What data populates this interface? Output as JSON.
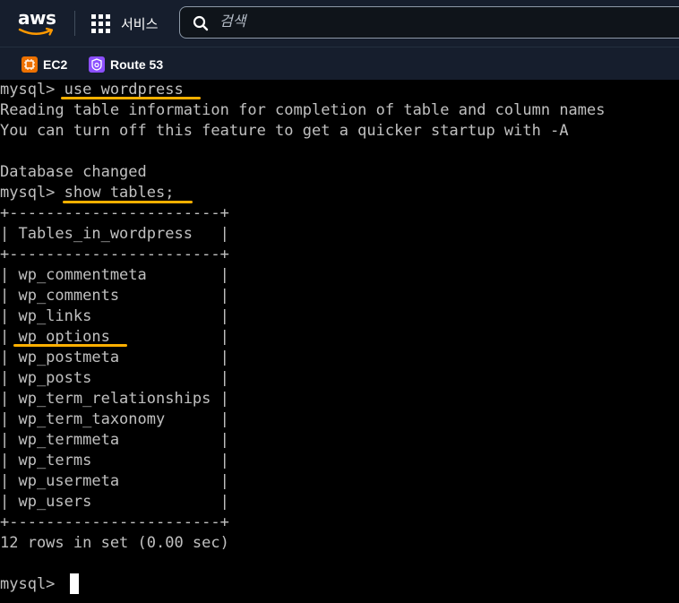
{
  "header": {
    "logo_text": "aws",
    "services_label": "서비스",
    "search_placeholder": "검색"
  },
  "favorites": [
    {
      "label": "EC2",
      "icon": "ec2-icon",
      "color": "#ed7100"
    },
    {
      "label": "Route 53",
      "icon": "route53-icon",
      "color": "#8c4fff"
    }
  ],
  "terminal": {
    "lines": [
      "mysql> use wordpress",
      "Reading table information for completion of table and column names",
      "You can turn off this feature to get a quicker startup with -A",
      "",
      "Database changed",
      "mysql> show tables;",
      "+-----------------------+",
      "| Tables_in_wordpress   |",
      "+-----------------------+",
      "| wp_commentmeta        |",
      "| wp_comments           |",
      "| wp_links              |",
      "| wp_options            |",
      "| wp_postmeta           |",
      "| wp_posts              |",
      "| wp_term_relationships |",
      "| wp_term_taxonomy      |",
      "| wp_termmeta           |",
      "| wp_terms              |",
      "| wp_usermeta           |",
      "| wp_users              |",
      "+-----------------------+",
      "12 rows in set (0.00 sec)",
      "",
      "mysql> "
    ],
    "highlight_color": "#ffb000"
  }
}
